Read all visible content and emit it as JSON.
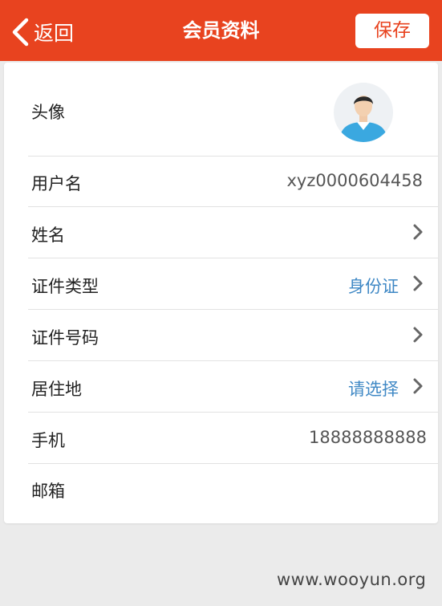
{
  "header": {
    "back_label": "返回",
    "title": "会员资料",
    "save_label": "保存"
  },
  "rows": [
    {
      "label": "头像",
      "value": ""
    },
    {
      "label": "用户名",
      "value": "xyz0000604458"
    },
    {
      "label": "姓名",
      "value": ""
    },
    {
      "label": "证件类型",
      "value": "身份证"
    },
    {
      "label": "证件号码",
      "value": ""
    },
    {
      "label": "居住地",
      "value": "请选择"
    },
    {
      "label": "手机",
      "value": "18888888888"
    },
    {
      "label": "邮箱",
      "value": ""
    }
  ],
  "watermark": "www.wooyun.org",
  "colors": {
    "header_bg": "#e8431f",
    "link": "#3f88c5"
  },
  "icons": {
    "back": "chevron-left-icon",
    "chevron": "chevron-right-icon",
    "avatar": "user-avatar-icon"
  }
}
